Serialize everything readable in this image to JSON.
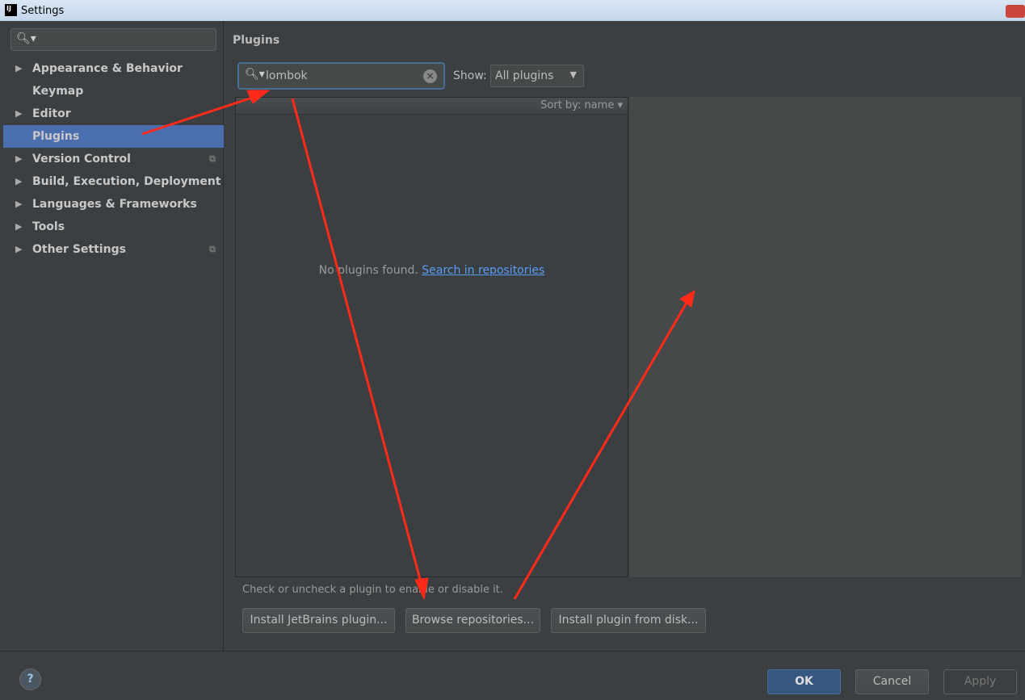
{
  "window": {
    "title": "Settings",
    "logo": "IJ"
  },
  "sidebar": {
    "search_placeholder": "",
    "items": [
      {
        "label": "Appearance & Behavior",
        "expandable": true
      },
      {
        "label": "Keymap",
        "expandable": false
      },
      {
        "label": "Editor",
        "expandable": true
      },
      {
        "label": "Plugins",
        "expandable": false,
        "selected": true
      },
      {
        "label": "Version Control",
        "expandable": true,
        "project_icon": true
      },
      {
        "label": "Build, Execution, Deployment",
        "expandable": true
      },
      {
        "label": "Languages & Frameworks",
        "expandable": true
      },
      {
        "label": "Tools",
        "expandable": true
      },
      {
        "label": "Other Settings",
        "expandable": true,
        "project_icon": true
      }
    ]
  },
  "main": {
    "title": "Plugins",
    "search_value": "lombok",
    "show_label": "Show:",
    "show_value": "All plugins",
    "sort_label": "Sort by: name",
    "empty_text": "No plugins found.",
    "empty_link": "Search in repositories",
    "hint": "Check or uncheck a plugin to enable or disable it.",
    "buttons": {
      "install_jetbrains": "Install JetBrains plugin...",
      "browse": "Browse repositories...",
      "install_disk": "Install plugin from disk..."
    }
  },
  "footer": {
    "help": "?",
    "ok": "OK",
    "cancel": "Cancel",
    "apply": "Apply"
  },
  "colors": {
    "accent": "#4b6eaf",
    "annotation": "#ff2a1a"
  }
}
